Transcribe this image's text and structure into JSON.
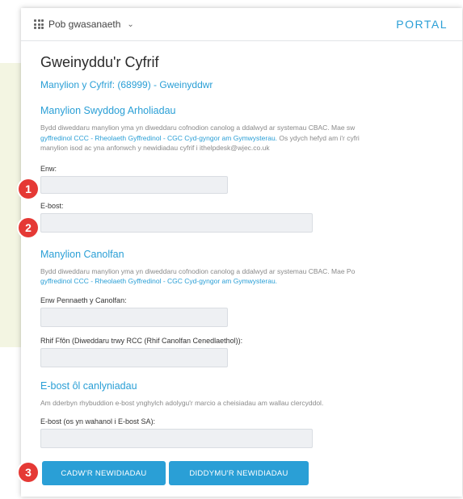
{
  "topbar": {
    "services_label": "Pob gwasanaeth",
    "portal_label": "PORTAL"
  },
  "page": {
    "title": "Gweinyddu'r Cyfrif",
    "account_line": "Manylion y Cyfrif: (68999) - Gweinyddwr"
  },
  "officer": {
    "heading": "Manylion Swyddog Arholiadau",
    "desc_line1": "Bydd diweddaru manylion yma yn diweddaru cofnodion canolog a ddalwyd ar systemau CBAC. Mae sw",
    "desc_line2_links": "gyffredinol CCC - Rheolaeth Gyffredinol - CGC Cyd-gyngor am Gymwysterau.",
    "desc_line2_rest": " Os ydych hefyd am i'r cyfri",
    "desc_line3": "manylion isod ac yna anfonwch y newidiadau cyfrif i ithelpdesk@wjec.co.uk",
    "name_label": "Enw:",
    "email_label": "E-bost:"
  },
  "centre": {
    "heading": "Manylion Canolfan",
    "desc_line1": "Bydd diweddaru manylion yma yn diweddaru cofnodion canolog a ddalwyd ar systemau CBAC. Mae Po",
    "desc_line2_links": "gyffredinol CCC - Rheolaeth Gyffredinol - CGC Cyd-gyngor am Gymwysterau.",
    "head_label": "Enw Pennaeth y Canolfan:",
    "phone_label": "Rhif Ffôn (Diweddaru trwy RCC (Rhif Canolfan Cenedlaethol)):"
  },
  "results_email": {
    "heading": "E-bost ôl canlyniadau",
    "desc": "Am dderbyn rhybuddion e-bost ynghylch adolygu'r marcio a cheisiadau am wallau clercyddol.",
    "email_label": "E-bost (os yn wahanol i E-bost SA):"
  },
  "buttons": {
    "save": "CADW'R NEWIDIADAU",
    "cancel": "DIDDYMU'R NEWIDIADAU"
  },
  "badges": [
    "1",
    "2",
    "3"
  ],
  "colors": {
    "accent": "#2a9fd6",
    "badge": "#e53935"
  }
}
